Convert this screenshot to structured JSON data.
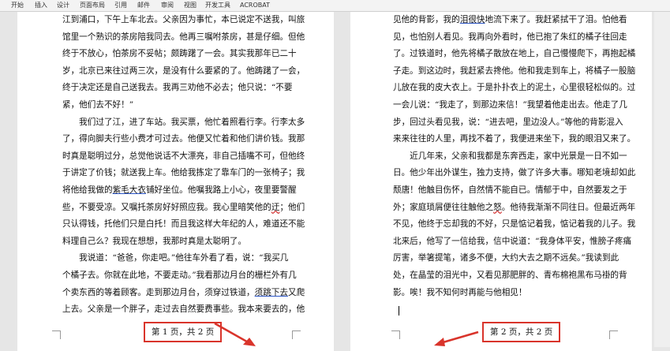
{
  "ribbon": {
    "tabs": [
      "开始",
      "插入",
      "设计",
      "页面布局",
      "引用",
      "邮件",
      "审阅",
      "视图",
      "开发工具",
      "ACROBAT"
    ]
  },
  "page1": {
    "lines": [
      [
        {
          "t": "江到浦口，下午上车北去。父亲因为事忙，本已说定不送我，叫旅"
        }
      ],
      [
        {
          "t": "馆里一个熟识的茶房陪我同去。他再三嘱咐茶房，甚是仔细。但他"
        }
      ],
      [
        {
          "t": "终于不放心，怕茶房不妥帖；颇踌躇了一会。其实我那年已二十"
        }
      ],
      [
        {
          "t": "岁，北京已来往过两三次，是没有什么要紧的了。他踌躇了一会，"
        }
      ],
      [
        {
          "t": "终于决定还是自己送我去。我再三劝他不必去；他只说：“不要"
        }
      ],
      [
        {
          "t": "紧，他们去不好！”"
        }
      ],
      [
        {
          "t": "　　我们过了江，进了车站。我买票，他忙着照看行李。行李太多"
        }
      ],
      [
        {
          "t": "了，得向脚夫行些小费才可过去。他便又忙着和他们讲价钱。我那"
        }
      ],
      [
        {
          "t": "时真是聪明过分，总觉他说话不大漂亮，非自己插嘴不可，但他终"
        }
      ],
      [
        {
          "t": "于讲定了价钱；就送我上车。他给我拣定了靠车门的一张椅子；我"
        }
      ],
      [
        {
          "t": "将他给我做的"
        },
        {
          "t": "紫毛大衣",
          "c": "u"
        },
        {
          "t": "铺好坐位。他嘱我路上小心，夜里要警醒"
        }
      ],
      [
        {
          "t": "些，不要受凉。又嘱托茶房好好照应我。我心里暗笑他的"
        },
        {
          "t": "迂",
          "c": "r"
        },
        {
          "t": "；他们"
        }
      ],
      [
        {
          "t": "只认得钱，托他们只是白托！而且我这样大年纪的人，难道还不能"
        }
      ],
      [
        {
          "t": "料理自己么？我现在想想，我那时真是太聪明了。"
        }
      ],
      [
        {
          "t": "　　我说道：“爸爸，你走吧。”他往车外看了看，说：“我买几"
        }
      ],
      [
        {
          "t": "个橘子去。你就在此地，不要走动。”我看那边月台的栅栏外有几"
        }
      ],
      [
        {
          "t": "个卖东西的等着顾客。走到那边月台，须穿过铁道，"
        },
        {
          "t": "须跳下去",
          "c": "u"
        },
        {
          "t": "又爬"
        }
      ],
      [
        {
          "t": "上去。父亲是一个胖子，走过去自然要费事些。我本来要去的，他"
        }
      ]
    ],
    "footer": "第 1 页，共 2 页"
  },
  "page2": {
    "lines": [
      [
        {
          "t": "见他的背影，我的"
        },
        {
          "t": "泪很快",
          "c": "u"
        },
        {
          "t": "地流下来了。我赶紧拭干了泪。怕他看"
        }
      ],
      [
        {
          "t": "见，也怕别人看见。我再向外看时，他已抱了朱红的橘子往回走"
        }
      ],
      [
        {
          "t": "了。过铁道时，他先将橘子散放在地上，自己慢慢爬下，再抱起橘"
        }
      ],
      [
        {
          "t": "子走。到这边时，我赶紧去搀他。他和我走到车上，将橘子一股脑"
        }
      ],
      [
        {
          "t": "儿放在我的皮大衣上。于是扑扑衣上的泥土，心里很轻松似的。过"
        }
      ],
      [
        {
          "t": "一会儿说：“我走了，到那边来信！”我望着他走出去。他走了几"
        }
      ],
      [
        {
          "t": "步，回过头看见我，说：“进去吧，里边没人。”等他的背影混入"
        }
      ],
      [
        {
          "t": "来来往往的人里，再找不着了，我便进来坐下，我的眼泪又来了。"
        }
      ],
      [
        {
          "t": "　　近几年来，父亲和我都是东奔西走，家中光景是一日不如一"
        }
      ],
      [
        {
          "t": "日。他少年出外谋生，独力支持，做了许多大事。哪知老境却如此"
        }
      ],
      [
        {
          "t": "颓唐！他触目伤怀，自然情不能自已。情郁于中，自然要发之于"
        }
      ],
      [
        {
          "t": "外；家庭琐屑便往往触他之"
        },
        {
          "t": "怒",
          "c": "r"
        },
        {
          "t": "。他待我渐渐不同往日。但最近两年"
        }
      ],
      [
        {
          "t": "不见，他终于忘却我的不好，只是惦记着我，惦记着我的儿子。我"
        }
      ],
      [
        {
          "t": "北来后，他写了一信给我，信中说道：“我身体平安，惟膀子疼痛"
        }
      ],
      [
        {
          "t": "厉害，举箸提笔，诸多不便，大约大去之期不远矣。”我读到此"
        }
      ],
      [
        {
          "t": "处，在晶莹的泪光中，又看见那肥胖的、青布棉袍黑布马褂的背"
        }
      ],
      [
        {
          "t": "影。唉！我不知何时再能与他相见！"
        }
      ]
    ],
    "footer": "第 2 页，共 2 页"
  },
  "colors": {
    "annotation_red": "#d9342b",
    "underline_blue": "#2b56c9"
  }
}
